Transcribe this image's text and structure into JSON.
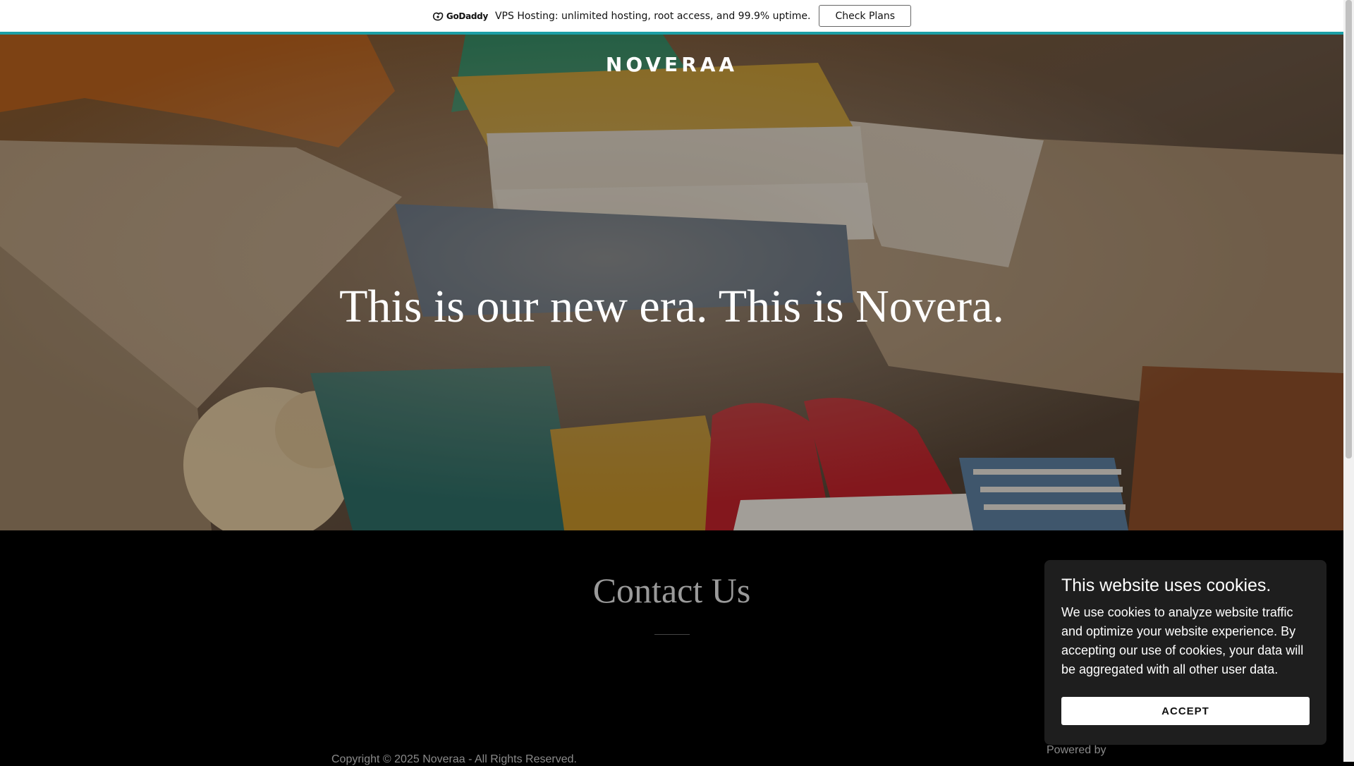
{
  "promo": {
    "logo": "GoDaddy",
    "text": "VPS Hosting: unlimited hosting, root access, and 99.9% uptime.",
    "button": "Check Plans"
  },
  "hero": {
    "brand": "NOVERAA",
    "headline": "This is our new era. This is Novera."
  },
  "contact": {
    "title": "Contact Us"
  },
  "footer": {
    "copyright": "Copyright © 2025 Noveraa - All Rights Reserved.",
    "powered_by": "Powered by"
  },
  "cookie": {
    "title": "This website uses cookies.",
    "body": "We use cookies to analyze website traffic and optimize your website experience. By accepting our use of cookies, your data will be aggregated with all other user data.",
    "accept": "ACCEPT"
  },
  "colors": {
    "promo_accent": "#1b9fa6",
    "footer_bg": "#000000",
    "cookie_bg": "#1e1e1e"
  }
}
